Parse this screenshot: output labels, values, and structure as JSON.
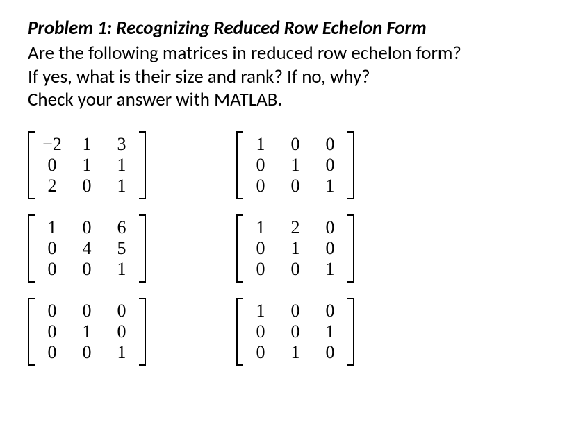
{
  "title": "Problem 1: Recognizing Reduced Row Echelon Form",
  "para_line1": "Are the following matrices in reduced row echelon form?",
  "para_line2": "If yes, what is their size and rank? If no, why?",
  "para_line3": "Check your answer with MATLAB.",
  "matrices": [
    {
      "rows": [
        [
          "−2",
          "1",
          "3"
        ],
        [
          "0",
          "1",
          "1"
        ],
        [
          "2",
          "0",
          "1"
        ]
      ]
    },
    {
      "rows": [
        [
          "1",
          "0",
          "0"
        ],
        [
          "0",
          "1",
          "0"
        ],
        [
          "0",
          "0",
          "1"
        ]
      ]
    },
    {
      "rows": [
        [
          "1",
          "0",
          "6"
        ],
        [
          "0",
          "4",
          "5"
        ],
        [
          "0",
          "0",
          "1"
        ]
      ]
    },
    {
      "rows": [
        [
          "1",
          "2",
          "0"
        ],
        [
          "0",
          "1",
          "0"
        ],
        [
          "0",
          "0",
          "1"
        ]
      ]
    },
    {
      "rows": [
        [
          "0",
          "0",
          "0"
        ],
        [
          "0",
          "1",
          "0"
        ],
        [
          "0",
          "0",
          "1"
        ]
      ]
    },
    {
      "rows": [
        [
          "1",
          "0",
          "0"
        ],
        [
          "0",
          "0",
          "1"
        ],
        [
          "0",
          "1",
          "0"
        ]
      ]
    }
  ],
  "chart_data": {
    "type": "table",
    "title": "Six 3x3 matrices for RREF recognition",
    "matrices": [
      [
        [
          -2,
          1,
          3
        ],
        [
          0,
          1,
          1
        ],
        [
          2,
          0,
          1
        ]
      ],
      [
        [
          1,
          0,
          0
        ],
        [
          0,
          1,
          0
        ],
        [
          0,
          0,
          1
        ]
      ],
      [
        [
          1,
          0,
          6
        ],
        [
          0,
          4,
          5
        ],
        [
          0,
          0,
          1
        ]
      ],
      [
        [
          1,
          2,
          0
        ],
        [
          0,
          1,
          0
        ],
        [
          0,
          0,
          1
        ]
      ],
      [
        [
          0,
          0,
          0
        ],
        [
          0,
          1,
          0
        ],
        [
          0,
          0,
          1
        ]
      ],
      [
        [
          1,
          0,
          0
        ],
        [
          0,
          0,
          1
        ],
        [
          0,
          1,
          0
        ]
      ]
    ]
  }
}
